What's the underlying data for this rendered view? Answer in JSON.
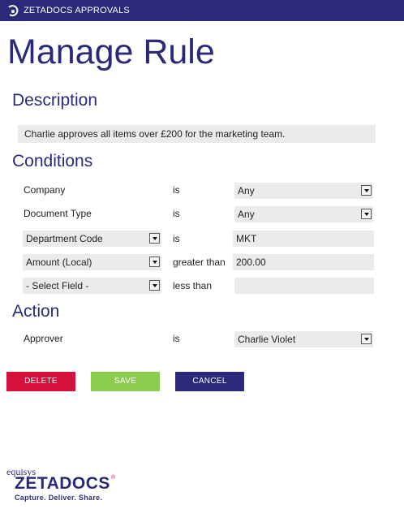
{
  "header": {
    "app_title": "ZETADOCS APPROVALS",
    "logo_icon": "zetadocs-logo-icon"
  },
  "page_title": "Manage Rule",
  "description": {
    "heading": "Description",
    "text": "Charlie approves all items over £200 for the marketing team."
  },
  "conditions": {
    "heading": "Conditions",
    "rows": [
      {
        "field": "Company",
        "operator": "is",
        "value": "Any"
      },
      {
        "field": "Document Type",
        "operator": "is",
        "value": "Any"
      },
      {
        "field": "Department Code",
        "operator": "is",
        "value": "MKT"
      },
      {
        "field": "Amount (Local)",
        "operator": "greater than",
        "value": "200.00"
      },
      {
        "field": "- Select Field -",
        "operator": "less than",
        "value": ""
      }
    ]
  },
  "action": {
    "heading": "Action",
    "field": "Approver",
    "operator": "is",
    "value": "Charlie Violet"
  },
  "buttons": {
    "delete": "DELETE",
    "save": "SAVE",
    "cancel": "CANCEL"
  },
  "footer": {
    "brand_top": "equisys",
    "brand": "ZETADOCS",
    "registered": "®",
    "tagline": "Capture. Deliver. Share."
  },
  "colors": {
    "primary": "#2b2a7a",
    "delete": "#d5103a",
    "save": "#8ccc4f",
    "field_bg": "#ebebeb"
  }
}
